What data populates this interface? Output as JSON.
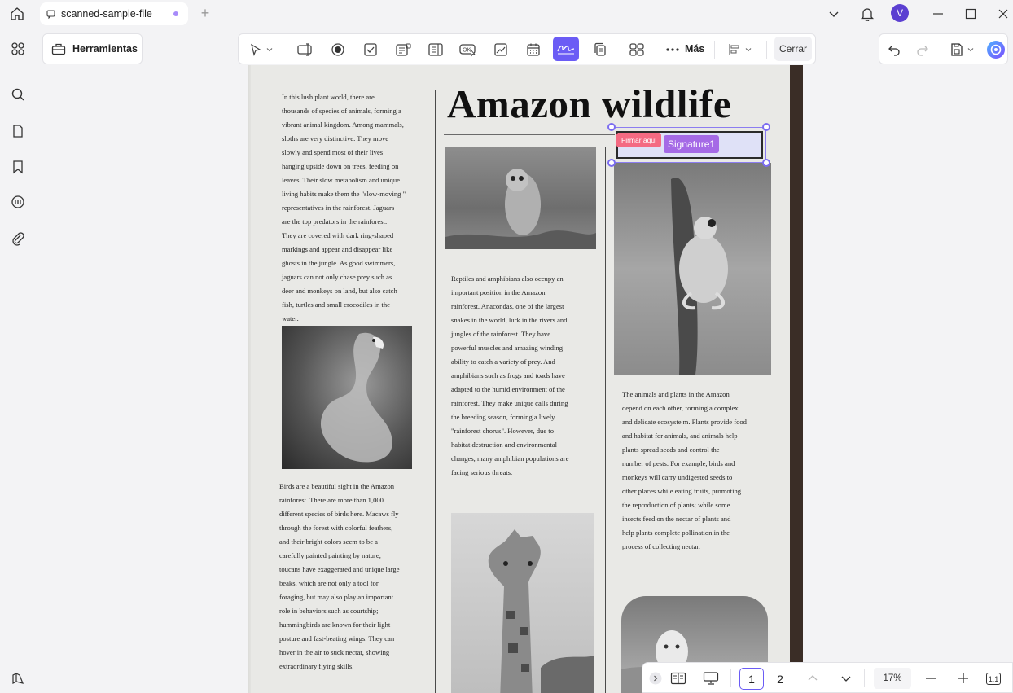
{
  "tab": {
    "title": "scanned-sample-file"
  },
  "user": {
    "avatar_letter": "V"
  },
  "toolbar": {
    "tools_label": "Herramientas",
    "more_label": "Más",
    "close_label": "Cerrar",
    "active_tool": "signature-field"
  },
  "document": {
    "heading": "Amazon wildlife",
    "col1_top": [
      "In this lush plant world, there are",
      "thousands of species of animals, forming a",
      "vibrant animal kingdom. Among mammals,",
      "sloths are very distinctive. They move",
      "slowly and spend most of their lives",
      "hanging upside down on trees, feeding on",
      "leaves. Their slow metabolism and unique",
      "living habits make them the \"slow-moving \"",
      "representatives in the rainforest. Jaguars",
      "are the top predators in the rainforest.",
      "They are covered with dark ring-shaped",
      "markings and appear and disappear like",
      "ghosts in the jungle. As good swimmers,",
      "jaguars can not only chase prey such as",
      "deer and monkeys on land, but also catch",
      "fish, turtles and small crocodiles in the",
      "water."
    ],
    "col1_bottom": [
      "Birds are a beautiful sight in the Amazon",
      "rainforest. There are more than 1,000",
      "different species of birds here. Macaws fly",
      "through the forest with colorful feathers,",
      "and their bright colors seem to be a",
      "carefully painted painting by nature;",
      "toucans have exaggerated and unique large",
      "beaks, which are not  only a tool for",
      "foraging, but may also play an important",
      "role in behaviors such as courtship;",
      "hummingbirds are known for their light",
      "posture and fast-beating wings. They can",
      "hover in the air to suck nectar, showing",
      "extraordinary flying skills."
    ],
    "col2": [
      "Reptiles and amphibians also occupy an",
      "important position in the Amazon",
      "rainforest. Anacondas, one of the largest",
      "snakes in the world, lurk in the rivers and",
      "jungles of the rainforest. They have",
      "powerful muscles and amazing winding",
      "ability to catch a variety of prey. And",
      "amphibians such as frogs and toads have",
      "adapted to the humid environment of the",
      "rainforest. They make unique calls during",
      "the breeding season, forming a lively",
      "\"rainforest chorus\". However, due to",
      "habitat destruction and environmental",
      "changes, many amphibian populations are",
      "facing serious threats."
    ],
    "col3": [
      "The animals and plants in the Amazon",
      "depend on each other, forming a complex",
      "and delicate ecosyste  m. Plants provide food",
      "and habitat for animals, and animals help",
      "plants spread seeds and control the",
      "number of pests. For example, birds and",
      "monkeys will carry undigested seeds to",
      "other places while eating fruits, promoting",
      "the reproduction of plants; while some",
      "insects feed on the nectar of plants and",
      "help plants complete pollination in the",
      "process of collecting nectar."
    ]
  },
  "signature_field": {
    "badge": "Firmar aquí",
    "name": "Signature1"
  },
  "pagebar": {
    "pages": [
      "1",
      "2"
    ],
    "current_page": "1",
    "zoom": "17%",
    "fit_label": "1:1"
  },
  "colors": {
    "accent": "#6b5cf5",
    "signature_badge": "#f46a82",
    "signature_label": "#a56ae6"
  }
}
